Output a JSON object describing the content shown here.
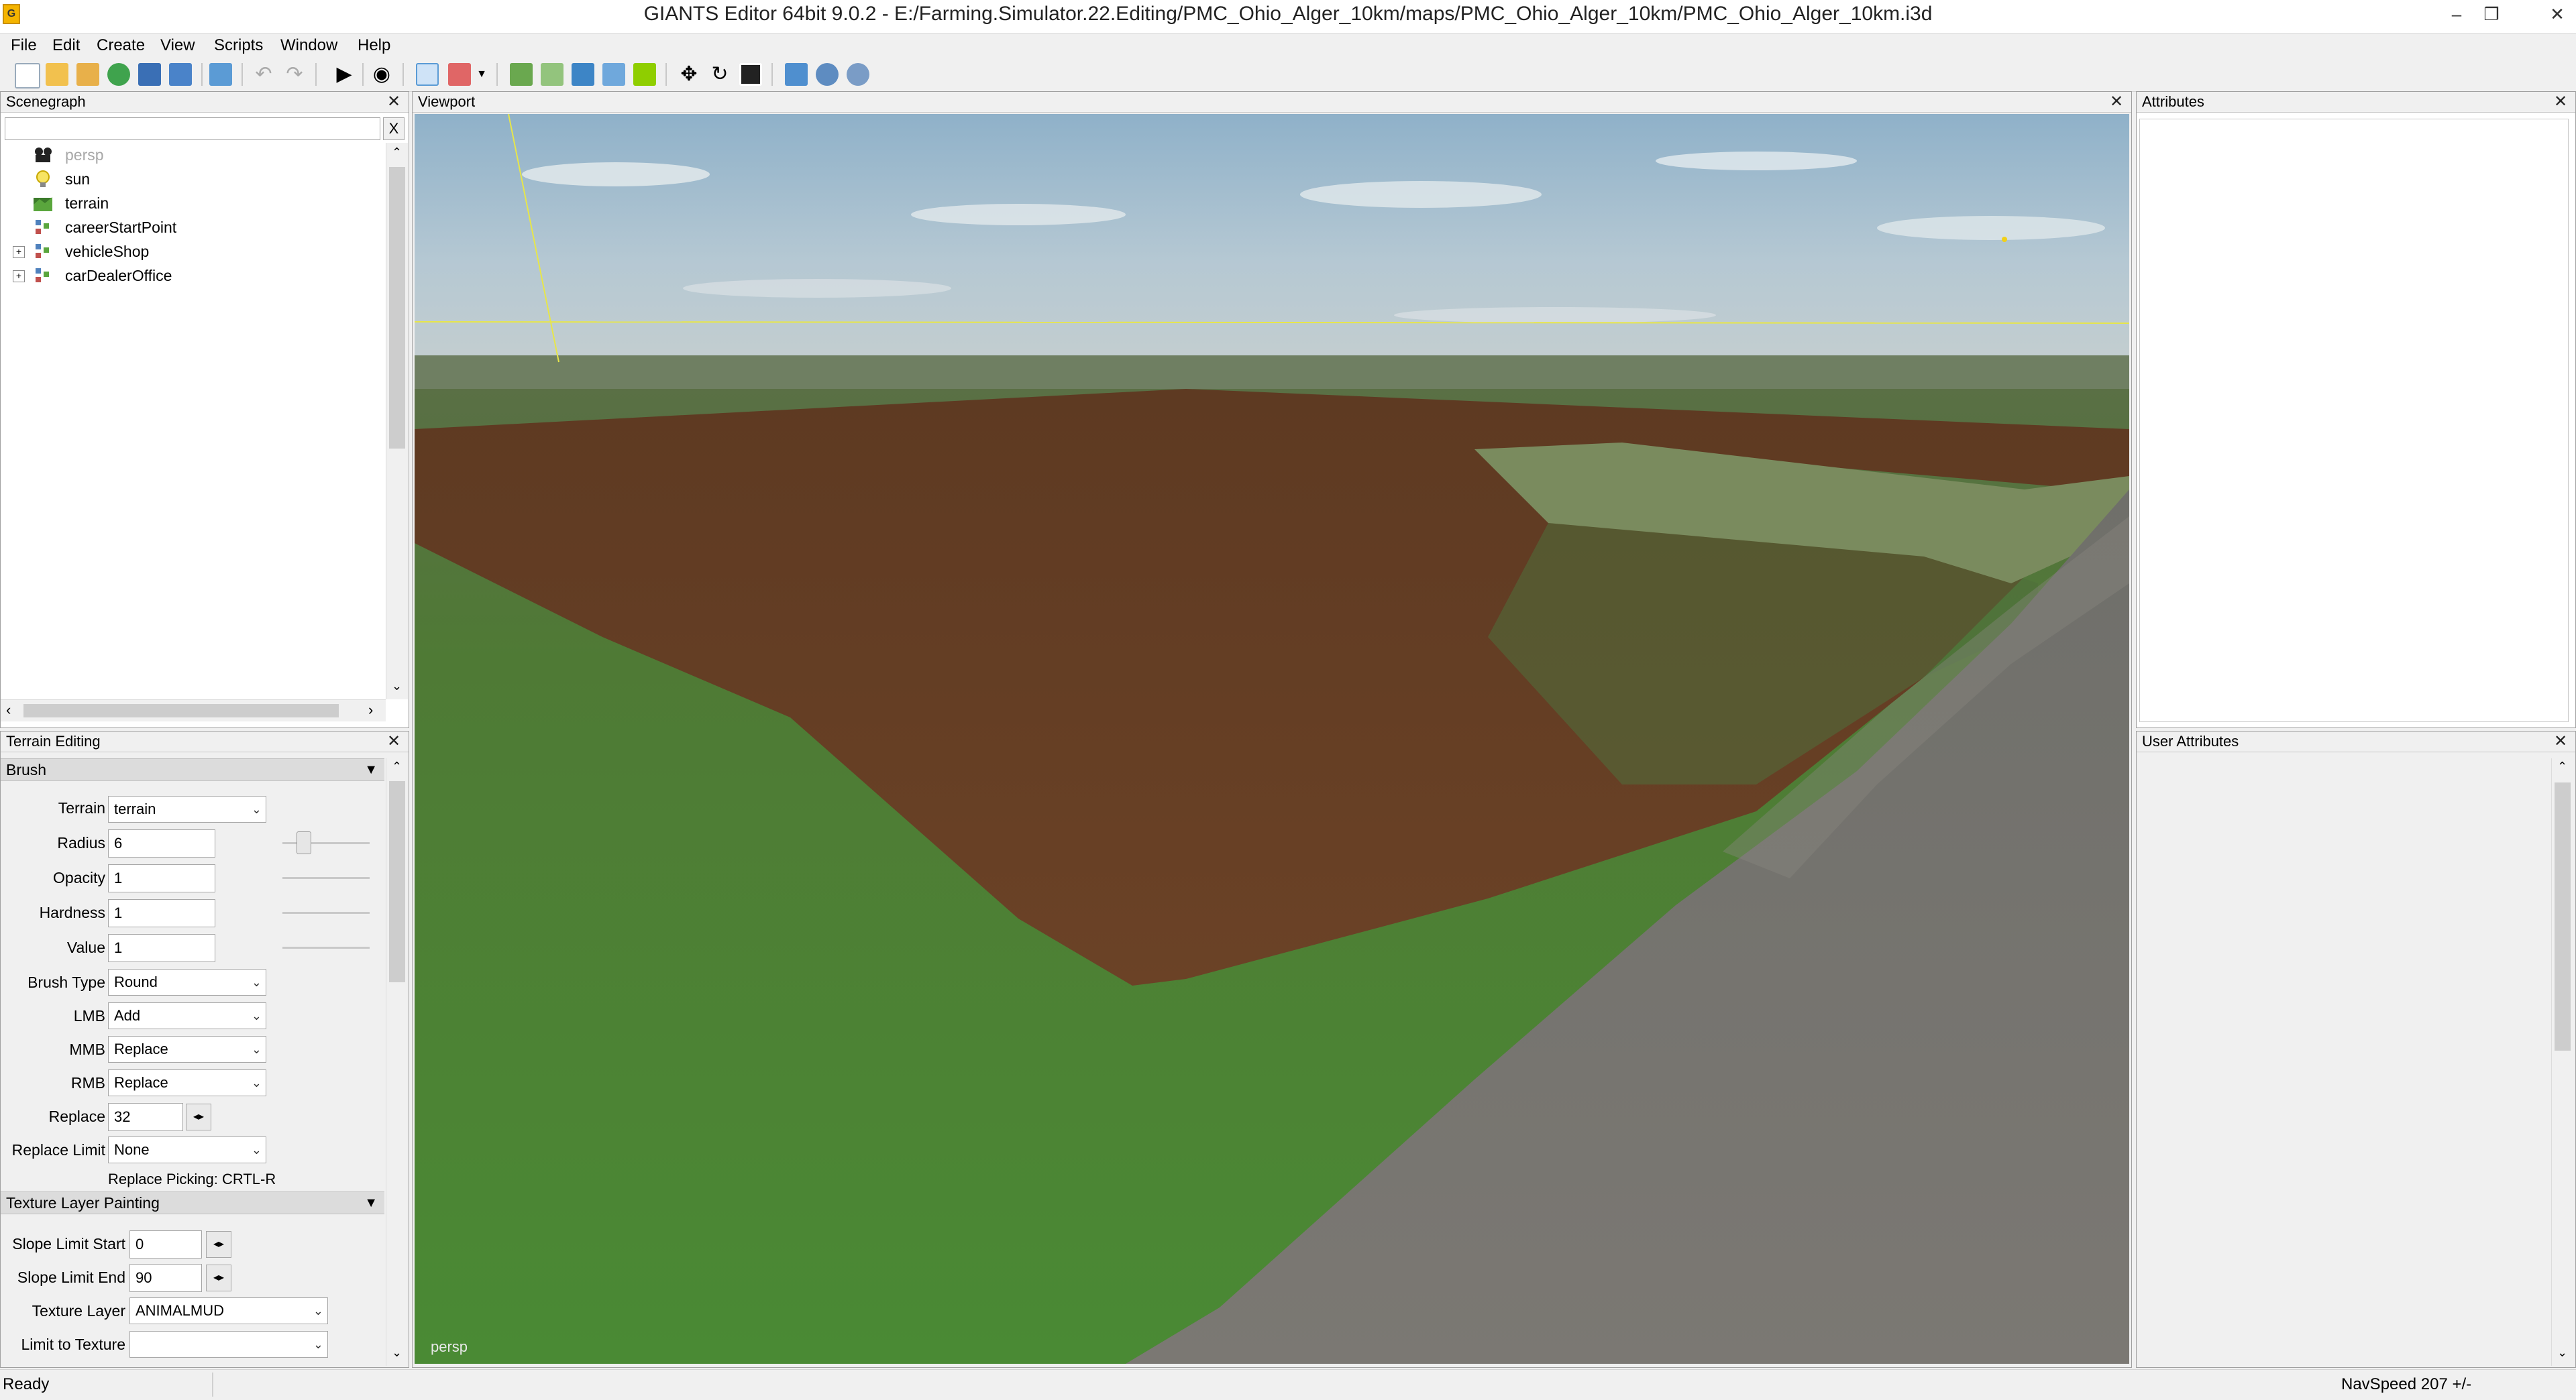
{
  "window": {
    "title": "GIANTS Editor 64bit 9.0.2 - E:/Farming.Simulator.22.Editing/PMC_Ohio_Alger_10km/maps/PMC_Ohio_Alger_10km/PMC_Ohio_Alger_10km.i3d",
    "minimize": "–",
    "restore": "❐",
    "close": "✕"
  },
  "menu": [
    "File",
    "Edit",
    "Create",
    "View",
    "Scripts",
    "Window",
    "Help"
  ],
  "toolbar": {
    "icons": [
      "new-file-icon",
      "open-file-icon",
      "edit-icon",
      "refresh-icon",
      "save-icon",
      "save-as-icon",
      "export-icon",
      "undo-icon",
      "redo-icon",
      "play-icon",
      "eye-icon",
      "select-icon",
      "brush-icon",
      "dropdown-icon",
      "terrain-sculpt-icon",
      "terrain-paint-icon",
      "foliage-paint-icon",
      "fill-icon",
      "tree-icon",
      "move-icon",
      "rotate-icon",
      "scale-icon",
      "map-icon",
      "settings-gear-icon",
      "gear-icon"
    ]
  },
  "scenegraph": {
    "title": "Scenegraph",
    "search_placeholder": "",
    "clear_label": "X",
    "items": [
      {
        "label": "persp",
        "icon": "camera-icon",
        "dimmed": true,
        "expandable": false
      },
      {
        "label": "sun",
        "icon": "light-bulb-icon",
        "dimmed": false,
        "expandable": false
      },
      {
        "label": "terrain",
        "icon": "terrain-icon",
        "dimmed": false,
        "expandable": false
      },
      {
        "label": "careerStartPoint",
        "icon": "transform-group-icon",
        "dimmed": false,
        "expandable": false
      },
      {
        "label": "vehicleShop",
        "icon": "transform-group-icon",
        "dimmed": false,
        "expandable": true
      },
      {
        "label": "carDealerOffice",
        "icon": "transform-group-icon",
        "dimmed": false,
        "expandable": true
      }
    ]
  },
  "terrain_editing": {
    "title": "Terrain Editing",
    "brush_header": "Brush",
    "terrain_label": "Terrain",
    "terrain_value": "terrain",
    "radius_label": "Radius",
    "radius_value": "6",
    "opacity_label": "Opacity",
    "opacity_value": "1",
    "hardness_label": "Hardness",
    "hardness_value": "1",
    "value_label": "Value",
    "value_value": "1",
    "brush_type_label": "Brush Type",
    "brush_type_value": "Round",
    "lmb_label": "LMB",
    "lmb_value": "Add",
    "mmb_label": "MMB",
    "mmb_value": "Replace",
    "rmb_label": "RMB",
    "rmb_value": "Replace",
    "replace_label": "Replace",
    "replace_value": "32",
    "replace_limit_label": "Replace Limit",
    "replace_limit_value": "None",
    "replace_picking_hint": "Replace Picking: CRTL-R",
    "texture_header": "Texture Layer Painting",
    "slope_start_label": "Slope Limit Start",
    "slope_start_value": "0",
    "slope_end_label": "Slope Limit End",
    "slope_end_value": "90",
    "texture_layer_label": "Texture Layer",
    "texture_layer_value": "ANIMALMUD",
    "limit_texture_label": "Limit to Texture",
    "limit_texture_value": ""
  },
  "viewport": {
    "title": "Viewport",
    "camera_label": "persp"
  },
  "attributes": {
    "title": "Attributes"
  },
  "user_attributes": {
    "title": "User Attributes"
  },
  "status": {
    "left": "Ready",
    "right": "NavSpeed 207 +/-"
  }
}
